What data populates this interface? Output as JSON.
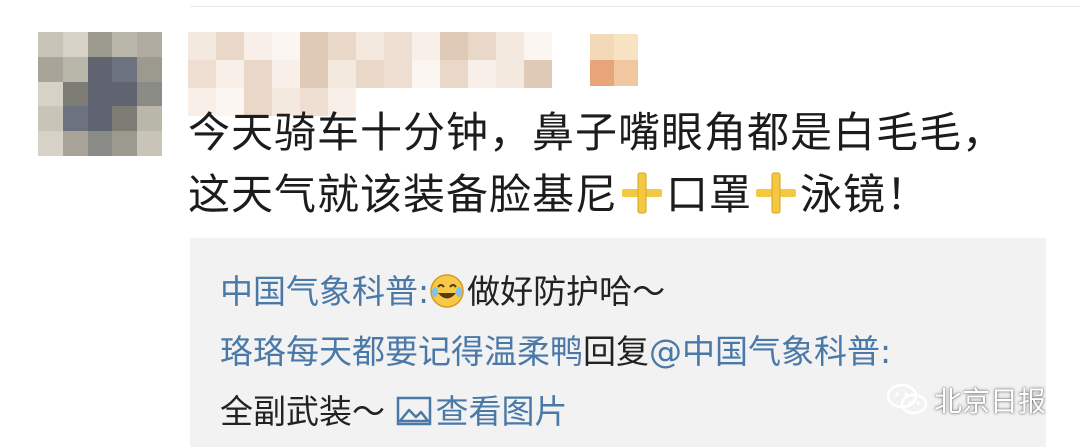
{
  "post": {
    "line1": "今天骑车十分钟，鼻子嘴眼角都是白毛毛，",
    "line2_a": "这天气就该装备脸基尼",
    "line2_b": "口罩",
    "line2_c": "泳镜！"
  },
  "replies": [
    {
      "author": "中国气象科普",
      "separator": ":",
      "text": "做好防护哈～"
    },
    {
      "author": "珞珞每天都要记得温柔鸭",
      "reply_word": "回复",
      "mention": "@中国气象科普",
      "separator": ":",
      "text": "全副武装～",
      "image_link": "查看图片"
    }
  ],
  "watermark": {
    "text": "北京日报"
  },
  "colors": {
    "link": "#4a79a8",
    "reply_bg": "#f2f2f2",
    "plus_icon": "#f5c842"
  },
  "icons": {
    "plus": "plus-icon",
    "emoji": "crying-laughing-emoji-icon",
    "picture": "picture-icon",
    "watermark": "wechat-icon"
  }
}
